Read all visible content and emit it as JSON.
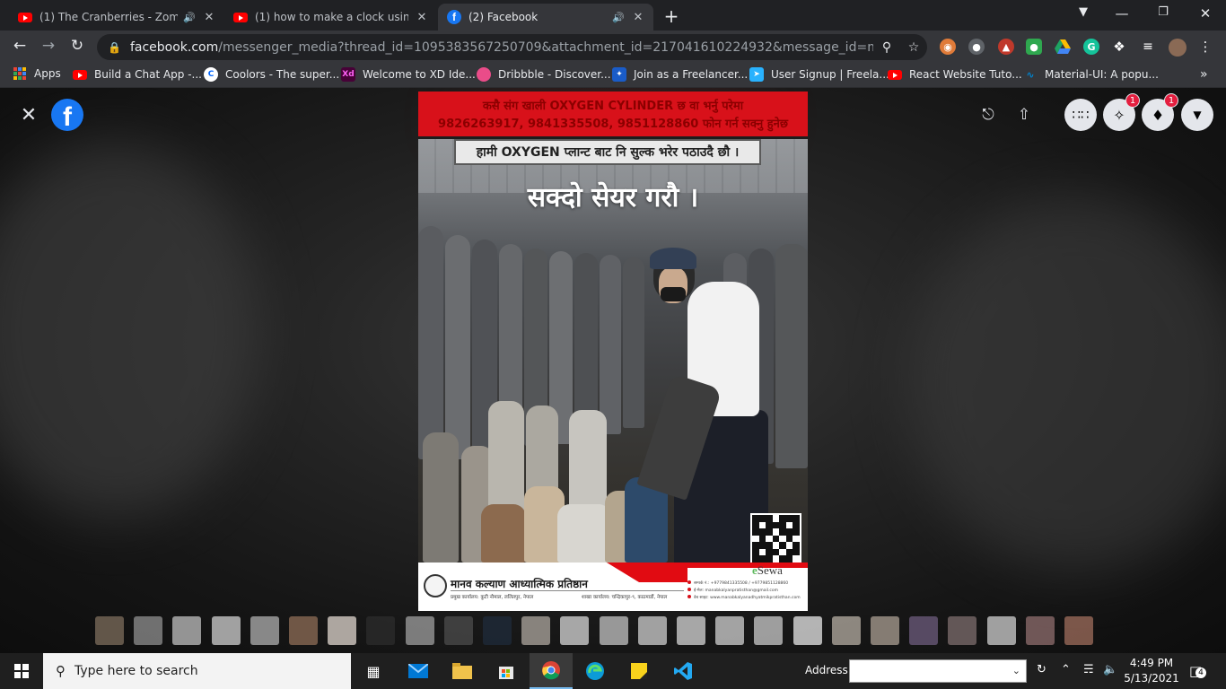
{
  "tabs": [
    {
      "title": "(1) The Cranberries - Zombie",
      "favicon": "youtube-icon",
      "audio": true
    },
    {
      "title": "(1) how to make a clock using htm",
      "favicon": "youtube-icon",
      "audio": true
    },
    {
      "title": "(2) Facebook",
      "favicon": "facebook-icon",
      "audio": true,
      "active": true
    }
  ],
  "address": {
    "host": "facebook.com",
    "path": "/messenger_media?thread_id=1095383567250709&attachment_id=217041610224932&message_id=mid.%24gAAPk..."
  },
  "bookmarks": {
    "apps_label": "Apps",
    "items": [
      {
        "label": "Build a Chat App -...",
        "icon": "youtube-icon"
      },
      {
        "label": "Coolors - The super...",
        "icon": "coolors-icon"
      },
      {
        "label": "Welcome to XD Ide...",
        "icon": "adobe-xd-icon"
      },
      {
        "label": "Dribbble - Discover...",
        "icon": "dribbble-icon"
      },
      {
        "label": "Join as a Freelancer...",
        "icon": "freelancer-icon"
      },
      {
        "label": "User Signup | Freela...",
        "icon": "freelancer-bird-icon"
      },
      {
        "label": "React Website Tuto...",
        "icon": "youtube-icon"
      },
      {
        "label": "Material-UI: A popu...",
        "icon": "material-ui-icon"
      }
    ],
    "overflow": "»"
  },
  "viewer": {
    "messenger_badge": "1",
    "notifications_badge": "1"
  },
  "poster": {
    "banner_line1": "कसै संग खाली OXYGEN CYLINDER छ वा भर्नु परेमा",
    "banner_line2": "9826263917, 9841335508, 9851128860 फोन गर्न सक्नु हुनेछ",
    "subtitle": "हामी OXYGEN प्लान्ट बाट नि सुल्क भरेर पठाउदै छौ ।",
    "share": "सक्दो सेयर गरौ ।",
    "org_name": "मानव कल्याण आध्यात्मिक प्रतिष्ठान",
    "org_address": "प्रमुख कार्यालय: कुटी नौमाल, ललितपुर, नेपाल",
    "branch_address": "शाखा कार्यालय: चन्द्रिकापुर-९, काठमाडौं, नेपाल",
    "esewa_e": "e",
    "esewa_rest": "Sewa",
    "contact_phone": "सम्पर्क नं.: +9779841335508 / +9779851128860",
    "contact_email": "ई-मेल: manabkalyanpratisthan@gmail.com",
    "contact_web": "वेब साइट: www.manabkalyanadhyatmikpratisthan.com"
  },
  "taskbar": {
    "search_placeholder": "Type here to search",
    "address_label": "Address",
    "time": "4:49 PM",
    "date": "5/13/2021",
    "notification_count": "4"
  }
}
